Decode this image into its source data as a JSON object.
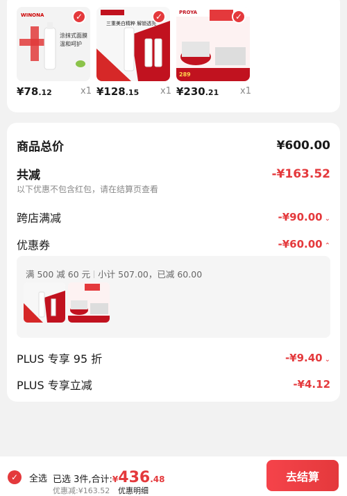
{
  "items": [
    {
      "price_int": "¥78",
      "price_dec": ".12",
      "qty": "x1",
      "brand": "WINONA"
    },
    {
      "price_int": "¥128",
      "price_dec": ".15",
      "qty": "x1",
      "brand": ""
    },
    {
      "price_int": "¥230",
      "price_dec": ".21",
      "qty": "x1",
      "brand": "PROYA"
    }
  ],
  "summary": {
    "goods_total_label": "商品总价",
    "goods_total_value": "¥600.00",
    "total_reduce_label": "共减",
    "total_reduce_value": "-¥163.52",
    "note": "以下优惠不包含红包，请在结算页查看",
    "cross_store_label": "跨店满减",
    "cross_store_value": "-¥90.00",
    "coupon_label": "优惠券",
    "coupon_value": "-¥60.00",
    "coupon_rule": "满 500 减 60 元",
    "coupon_subtotal": "小计 507.00，已减 60.00",
    "plus95_label": "PLUS 专享 95 折",
    "plus95_value": "-¥9.40",
    "plus_direct_label": "PLUS 专享立减",
    "plus_direct_value": "-¥4.12"
  },
  "bottom": {
    "select_all": "全选",
    "selected_text": "已选 3件,合计:",
    "total_yen": "¥",
    "total_int": "436",
    "total_dec": ".48",
    "discount_text": "优惠减:¥163.52",
    "detail_text": "优惠明细",
    "checkout_label": "去结算"
  },
  "colors": {
    "accent": "#e4393c"
  }
}
